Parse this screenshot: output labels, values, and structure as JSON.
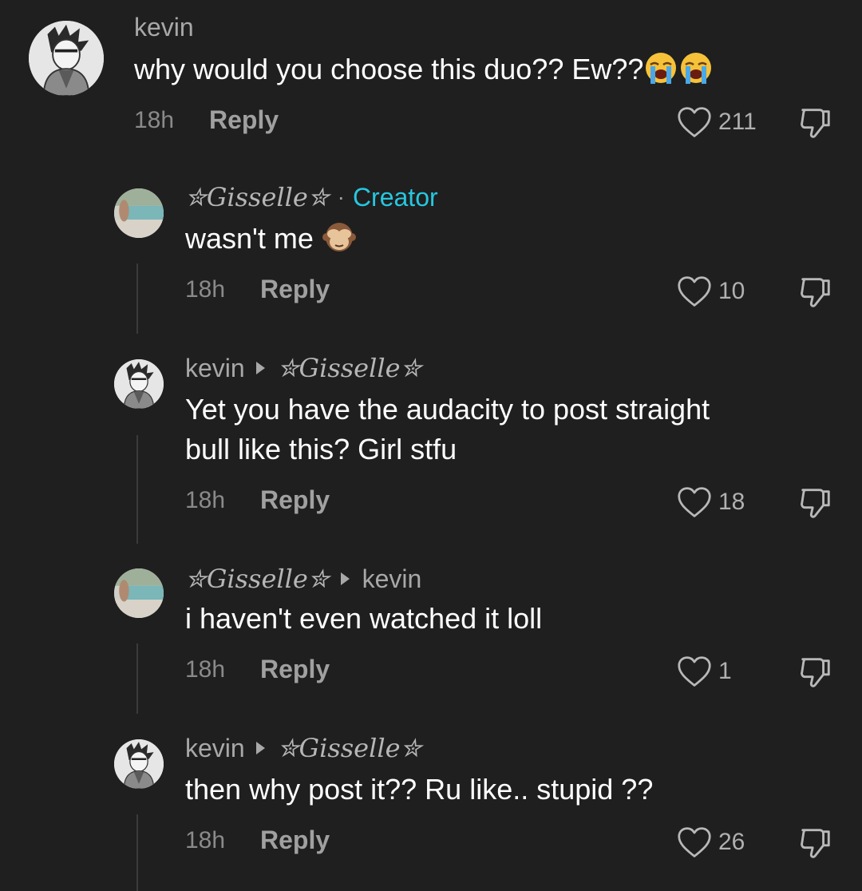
{
  "comments": [
    {
      "user": "kevin",
      "text": "why would you choose this duo?? Ew??",
      "emoji": [
        "loudly-crying-face",
        "loudly-crying-face"
      ],
      "time": "18h",
      "reply_label": "Reply",
      "likes": "211"
    },
    {
      "user": "✮Gisselle✮",
      "creator_dot": "·",
      "creator_label": "Creator",
      "text": "wasn't me",
      "emoji": [
        "see-no-evil-monkey"
      ],
      "time": "18h",
      "reply_label": "Reply",
      "likes": "10"
    },
    {
      "user": "kevin",
      "reply_to": "✮Gisselle✮",
      "text_line1": "Yet you have the audacity to post straight",
      "text_line2": "bull like this? Girl stfu",
      "time": "18h",
      "reply_label": "Reply",
      "likes": "18"
    },
    {
      "user": "✮Gisselle✮",
      "reply_to": "kevin",
      "text": "i haven't even watched it loll",
      "time": "18h",
      "reply_label": "Reply",
      "likes": "1"
    },
    {
      "user": "kevin",
      "reply_to": "✮Gisselle✮",
      "text": "then why post it?? Ru like.. stupid ??",
      "time": "18h",
      "reply_label": "Reply",
      "likes": "26"
    }
  ],
  "colors": {
    "background": "#1f1f1f",
    "creator": "#27c7e0",
    "muted": "#a8a8a8"
  }
}
